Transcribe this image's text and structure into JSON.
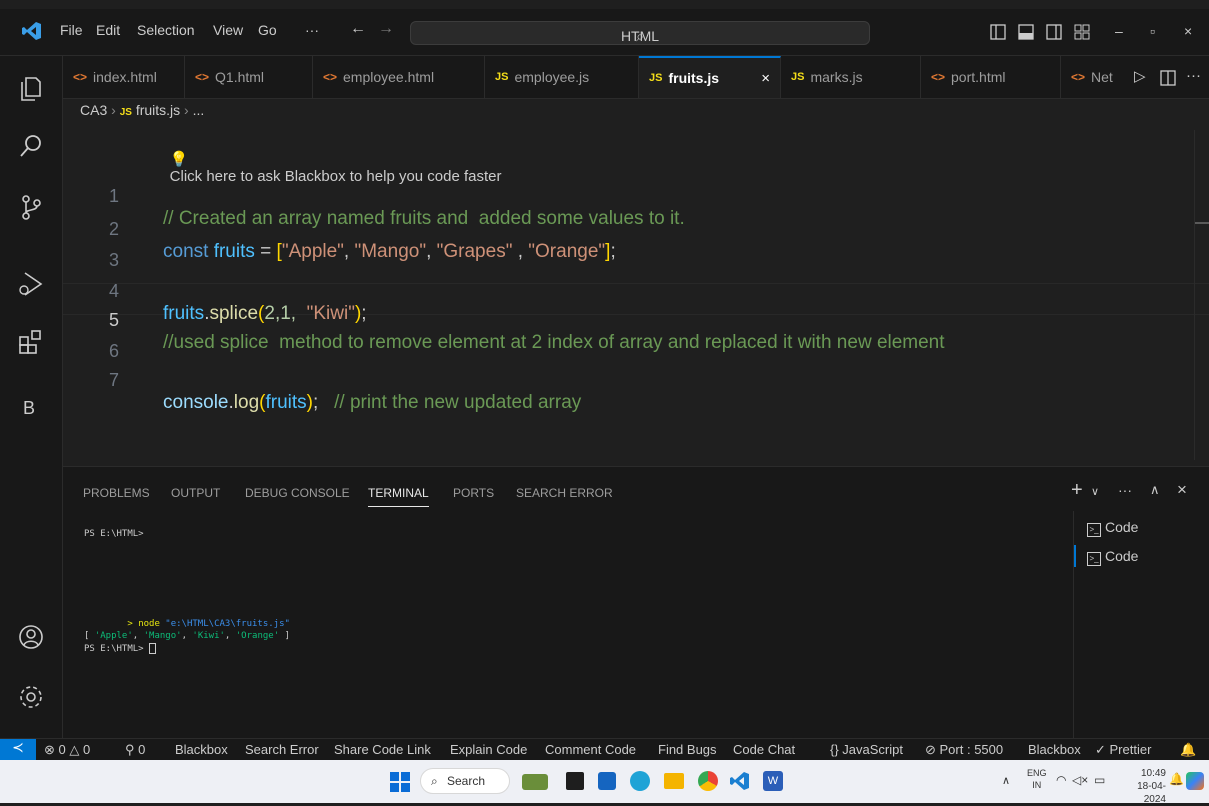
{
  "titlebar": {
    "menu": [
      "File",
      "Edit",
      "Selection",
      "View",
      "Go",
      "···"
    ],
    "search": "HTML",
    "window_controls": [
      "–",
      "▫",
      "×"
    ]
  },
  "tabs": [
    {
      "label": "index.html",
      "type": "html"
    },
    {
      "label": "Q1.html",
      "type": "html"
    },
    {
      "label": "employee.html",
      "type": "html"
    },
    {
      "label": "employee.js",
      "type": "js"
    },
    {
      "label": "fruits.js",
      "type": "js",
      "active": true
    },
    {
      "label": "marks.js",
      "type": "js"
    },
    {
      "label": "port.html",
      "type": "html"
    },
    {
      "label": "Net",
      "type": "html"
    }
  ],
  "breadcrumb": {
    "folder": "CA3",
    "file": "fruits.js",
    "more": "..."
  },
  "blackbox_hint": "Click here to ask Blackbox to help you code faster",
  "code": {
    "line_numbers": [
      "1",
      "2",
      "3",
      "4",
      "5",
      "6",
      "7"
    ],
    "l1": "// Created an array named fruits and  added some values to it.",
    "l2_kw": "const",
    "l2_var": "fruits",
    "l2_eq": " = ",
    "l2_open": "[",
    "l2_s1": "\"Apple\"",
    "l2_s2": "\"Mango\"",
    "l2_s3": "\"Grapes\"",
    "l2_s4": "\"Orange\"",
    "l2_close": "]",
    "l4_var": "fruits",
    "l4_fn": "splice",
    "l4_args_num": "2,1,",
    "l4_str": "\"Kiwi\"",
    "l5": "//used splice  method to remove element at 2 index of array and replaced it with new element",
    "l7_obj": "console",
    "l7_fn": "log",
    "l7_arg": "fruits",
    "l7_cmt": "// print the new updated array"
  },
  "panel": {
    "tabs": [
      "PROBLEMS",
      "OUTPUT",
      "DEBUG CONSOLE",
      "TERMINAL",
      "PORTS",
      "SEARCH ERROR"
    ],
    "active_tab": "TERMINAL",
    "terminal_lines": {
      "prompt1": "PS E:\\HTML>",
      "cmd_arrow": "> node ",
      "cmd_path": "\"e:\\HTML\\CA3\\fruits.js\"",
      "out_open": "[ ",
      "out_items": [
        "'Apple'",
        "'Mango'",
        "'Kiwi'",
        "'Orange'"
      ],
      "out_close": " ]",
      "prompt2": "PS E:\\HTML>"
    },
    "terminals": [
      "Code",
      "Code"
    ]
  },
  "statusbar": {
    "errors": "0",
    "warnings": "0",
    "ports": "0",
    "items": [
      "Blackbox",
      "Search Error",
      "Share Code Link",
      "Explain Code",
      "Comment Code",
      "Find Bugs",
      "Code Chat"
    ],
    "language": "JavaScript",
    "port": "Port : 5500",
    "blackbox": "Blackbox",
    "prettier": "Prettier"
  },
  "taskbar": {
    "search": "Search",
    "lang_top": "ENG",
    "lang_bottom": "IN",
    "time": "10:49",
    "date": "18-04-2024"
  },
  "colors": {
    "accent": "#0078d4",
    "comment": "#6a9955",
    "keyword": "#569cd6",
    "string": "#ce9178"
  }
}
